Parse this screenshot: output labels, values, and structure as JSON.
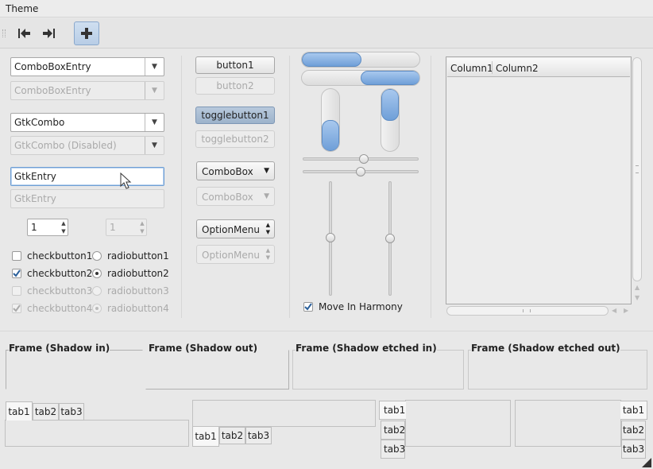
{
  "window": {
    "title": "Theme"
  },
  "toolbar": {
    "items": [
      {
        "icon": "goto-first-icon"
      },
      {
        "icon": "goto-last-icon"
      },
      {
        "icon": "add-icon"
      }
    ]
  },
  "combos": {
    "entry1": "ComboBoxEntry",
    "entry2": "ComboBoxEntry",
    "gtkcombo1": "GtkCombo",
    "gtkcombo2": "GtkCombo (Disabled)",
    "combobox1": "ComboBox",
    "combobox2": "ComboBox"
  },
  "entries": {
    "entry1": "GtkEntry",
    "entry2": "GtkEntry"
  },
  "spins": {
    "spin1": "1",
    "spin2": "1"
  },
  "checks": {
    "c1": "checkbutton1",
    "c2": "checkbutton2",
    "c3": "checkbutton3",
    "c4": "checkbutton4"
  },
  "radios": {
    "r1": "radiobutton1",
    "r2": "radiobutton2",
    "r3": "radiobutton3",
    "r4": "radiobutton4"
  },
  "buttons": {
    "b1": "button1",
    "b2": "button2",
    "t1": "togglebutton1",
    "t2": "togglebutton2"
  },
  "optionmenus": {
    "o1": "OptionMenu",
    "o2": "OptionMenu"
  },
  "progress": {
    "h1": 0.5,
    "h2": 0.5,
    "v1": 0.5,
    "v2": 0.5
  },
  "sliders": {
    "move_in_harmony": "Move In Harmony"
  },
  "tree": {
    "columns": [
      "Column1",
      "Column2"
    ]
  },
  "frames": {
    "f1": "Frame (Shadow in)",
    "f2": "Frame (Shadow out)",
    "f3": "Frame (Shadow etched in)",
    "f4": "Frame (Shadow etched out)"
  },
  "notebooks": {
    "tabs": [
      "tab1",
      "tab2",
      "tab3"
    ]
  },
  "colors": {
    "accent": "#6f9fd8",
    "background": "#e8e8e8"
  }
}
